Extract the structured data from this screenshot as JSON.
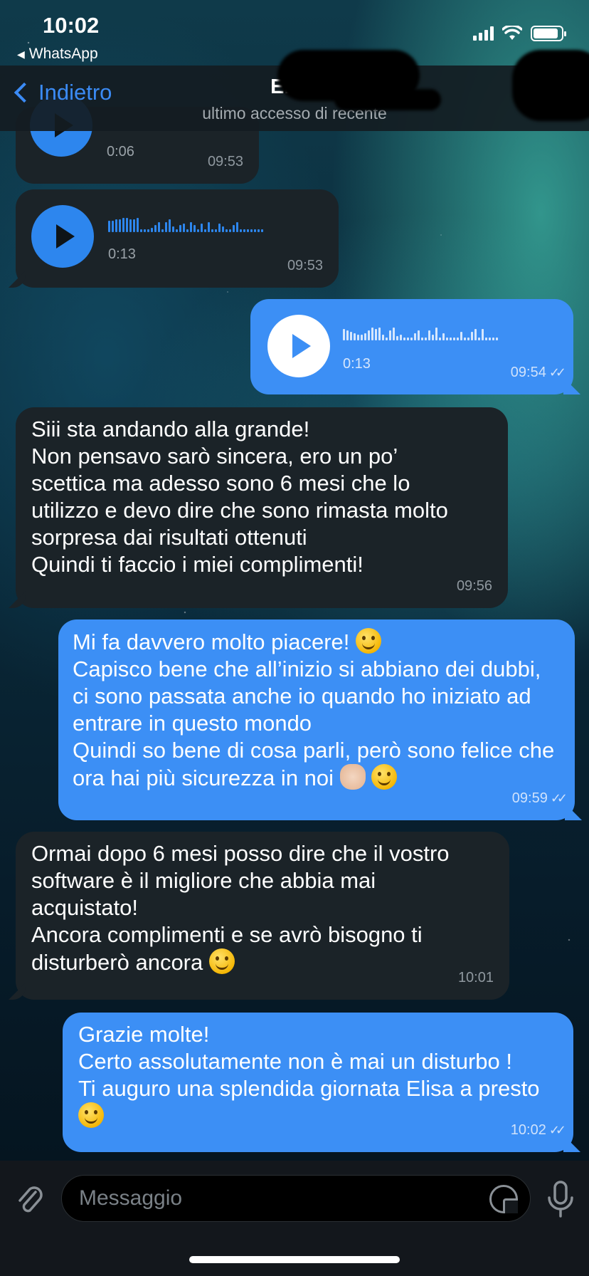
{
  "status_bar": {
    "time": "10:02",
    "back_app": "WhatsApp",
    "battery_level": 0.9
  },
  "header": {
    "back_label": "Indietro",
    "contact_name": "Elisa",
    "status": "ultimo accesso di recente"
  },
  "messages": [
    {
      "direction": "in",
      "type": "voice",
      "duration": "0:06",
      "time": "09:53"
    },
    {
      "direction": "in",
      "type": "voice",
      "duration": "0:13",
      "time": "09:53"
    },
    {
      "direction": "out",
      "type": "voice",
      "duration": "0:13",
      "time": "09:54",
      "read": true
    },
    {
      "direction": "in",
      "type": "text",
      "text": "Siii sta andando alla grande!\nNon pensavo sarò sincera, ero un po’ scettica ma adesso sono 6 mesi che lo utilizzo e devo dire che sono rimasta molto sorpresa dai risultati ottenuti\nQuindi ti faccio i miei complimenti!",
      "time": "09:56"
    },
    {
      "direction": "out",
      "type": "text",
      "text_a": "Mi fa davvero molto piacere! ",
      "emoji_a": "grinning-face",
      "text_b": "\nCapisco bene che all’inizio si abbiano dei dubbi, ci sono passata anche io quando ho iniziato ad entrare in questo mondo\nQuindi so bene di cosa parli, però sono felice che ora hai più sicurezza in noi ",
      "emoji_b": "ok-hand",
      "emoji_c": "grinning-face",
      "time": "09:59",
      "read": true
    },
    {
      "direction": "in",
      "type": "text",
      "text": "Ormai dopo 6 mesi posso dire che il vostro software è il migliore che abbia mai acquistato!\nAncora complimenti e se avrò bisogno ti disturberò ancora ",
      "emoji": "slightly-smiling-face",
      "time": "10:01"
    },
    {
      "direction": "out",
      "type": "text",
      "text": "Grazie molte!\nCerto assolutamente non è mai un disturbo !\nTi auguro una splendida giornata Elisa a presto ",
      "emoji": "grinning-face",
      "time": "10:02",
      "read": true
    }
  ],
  "input": {
    "placeholder": "Messaggio"
  },
  "icons": [
    "back-chevron-icon",
    "attach-icon",
    "sticker-icon",
    "microphone-icon",
    "signal-icon",
    "wifi-icon",
    "battery-icon",
    "play-icon",
    "read-ticks-icon"
  ],
  "colors": {
    "outgoing_bubble": "#3c8ff5",
    "incoming_bubble": "#1b2328",
    "accent": "#3b8bf5"
  }
}
